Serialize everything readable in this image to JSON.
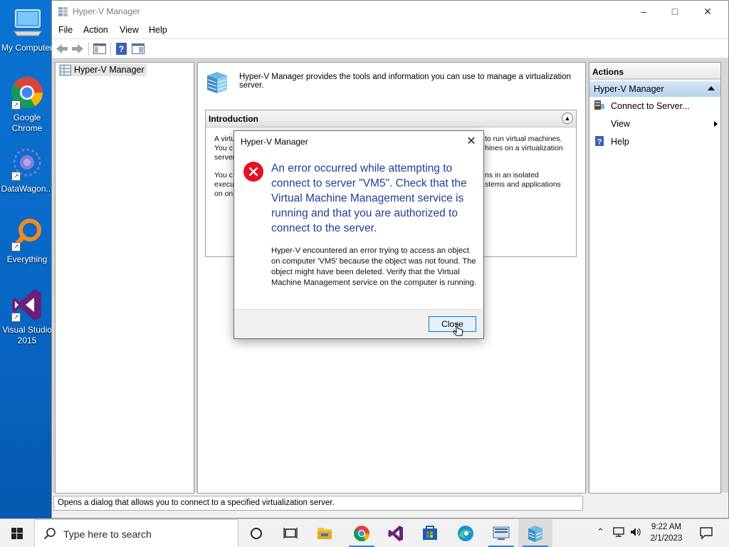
{
  "desktop": {
    "icons": [
      {
        "label": "My Computer",
        "icon": "computer-icon"
      },
      {
        "label": "Google Chrome",
        "icon": "chrome-icon"
      },
      {
        "label": "DataWagon...",
        "icon": "datawagon-icon"
      },
      {
        "label": "Everything",
        "icon": "everything-search-icon"
      },
      {
        "label": "Visual Studio 2015",
        "icon": "visual-studio-icon"
      }
    ]
  },
  "window": {
    "title": "Hyper-V Manager",
    "menu": [
      "File",
      "Action",
      "View",
      "Help"
    ],
    "tree": {
      "root_label": "Hyper-V Manager"
    },
    "center": {
      "header_text": "Hyper-V Manager provides the tools and information you can use to manage a virtualization server.",
      "intro_title": "Introduction",
      "intro_paragraph_1_visible": [
        "A virtu",
        "You c",
        "server"
      ],
      "intro_paragraph_1_right": [
        "to run virtual machines.",
        "hines on a virtualization"
      ],
      "intro_paragraph_2_visible": [
        "You c",
        "execu",
        "on on"
      ],
      "intro_paragraph_2_right": [
        "ns in an isolated",
        "stems and applications"
      ]
    },
    "actions": {
      "header": "Actions",
      "group": "Hyper-V Manager",
      "items": [
        {
          "label": "Connect to Server...",
          "icon": "connect-server-icon"
        },
        {
          "label": "View",
          "icon": "",
          "submenu": true
        },
        {
          "label": "Help",
          "icon": "help-icon"
        }
      ]
    },
    "status_text": "Opens a dialog that allows you to connect to a specified virtualization server."
  },
  "dialog": {
    "title": "Hyper-V Manager",
    "main_instruction": "An error occurred while attempting to connect to server \"VM5\". Check that the Virtual Machine Management service is running and that you are authorized to connect to the server.",
    "detail": "Hyper-V encountered an error trying to access an object on computer 'VM5' because the object was not found. The object might have been deleted. Verify that the Virtual Machine Management service on the computer is running.",
    "close_label": "Close"
  },
  "taskbar": {
    "search_placeholder": "Type here to search",
    "time": "9:22 AM",
    "date": "2/1/2023",
    "apps": [
      "cortana-icon",
      "task-view-icon",
      "file-explorer-icon",
      "chrome-icon",
      "visual-studio-icon",
      "store-icon",
      "edge-icon",
      "remote-desktop-icon",
      "hyper-v-manager-icon"
    ]
  },
  "colors": {
    "desktop_bg": "#0a6cc8",
    "dialog_instruction": "#1f3f9c",
    "error_red": "#e81123",
    "actions_group_bg": "#c6dcf1"
  }
}
